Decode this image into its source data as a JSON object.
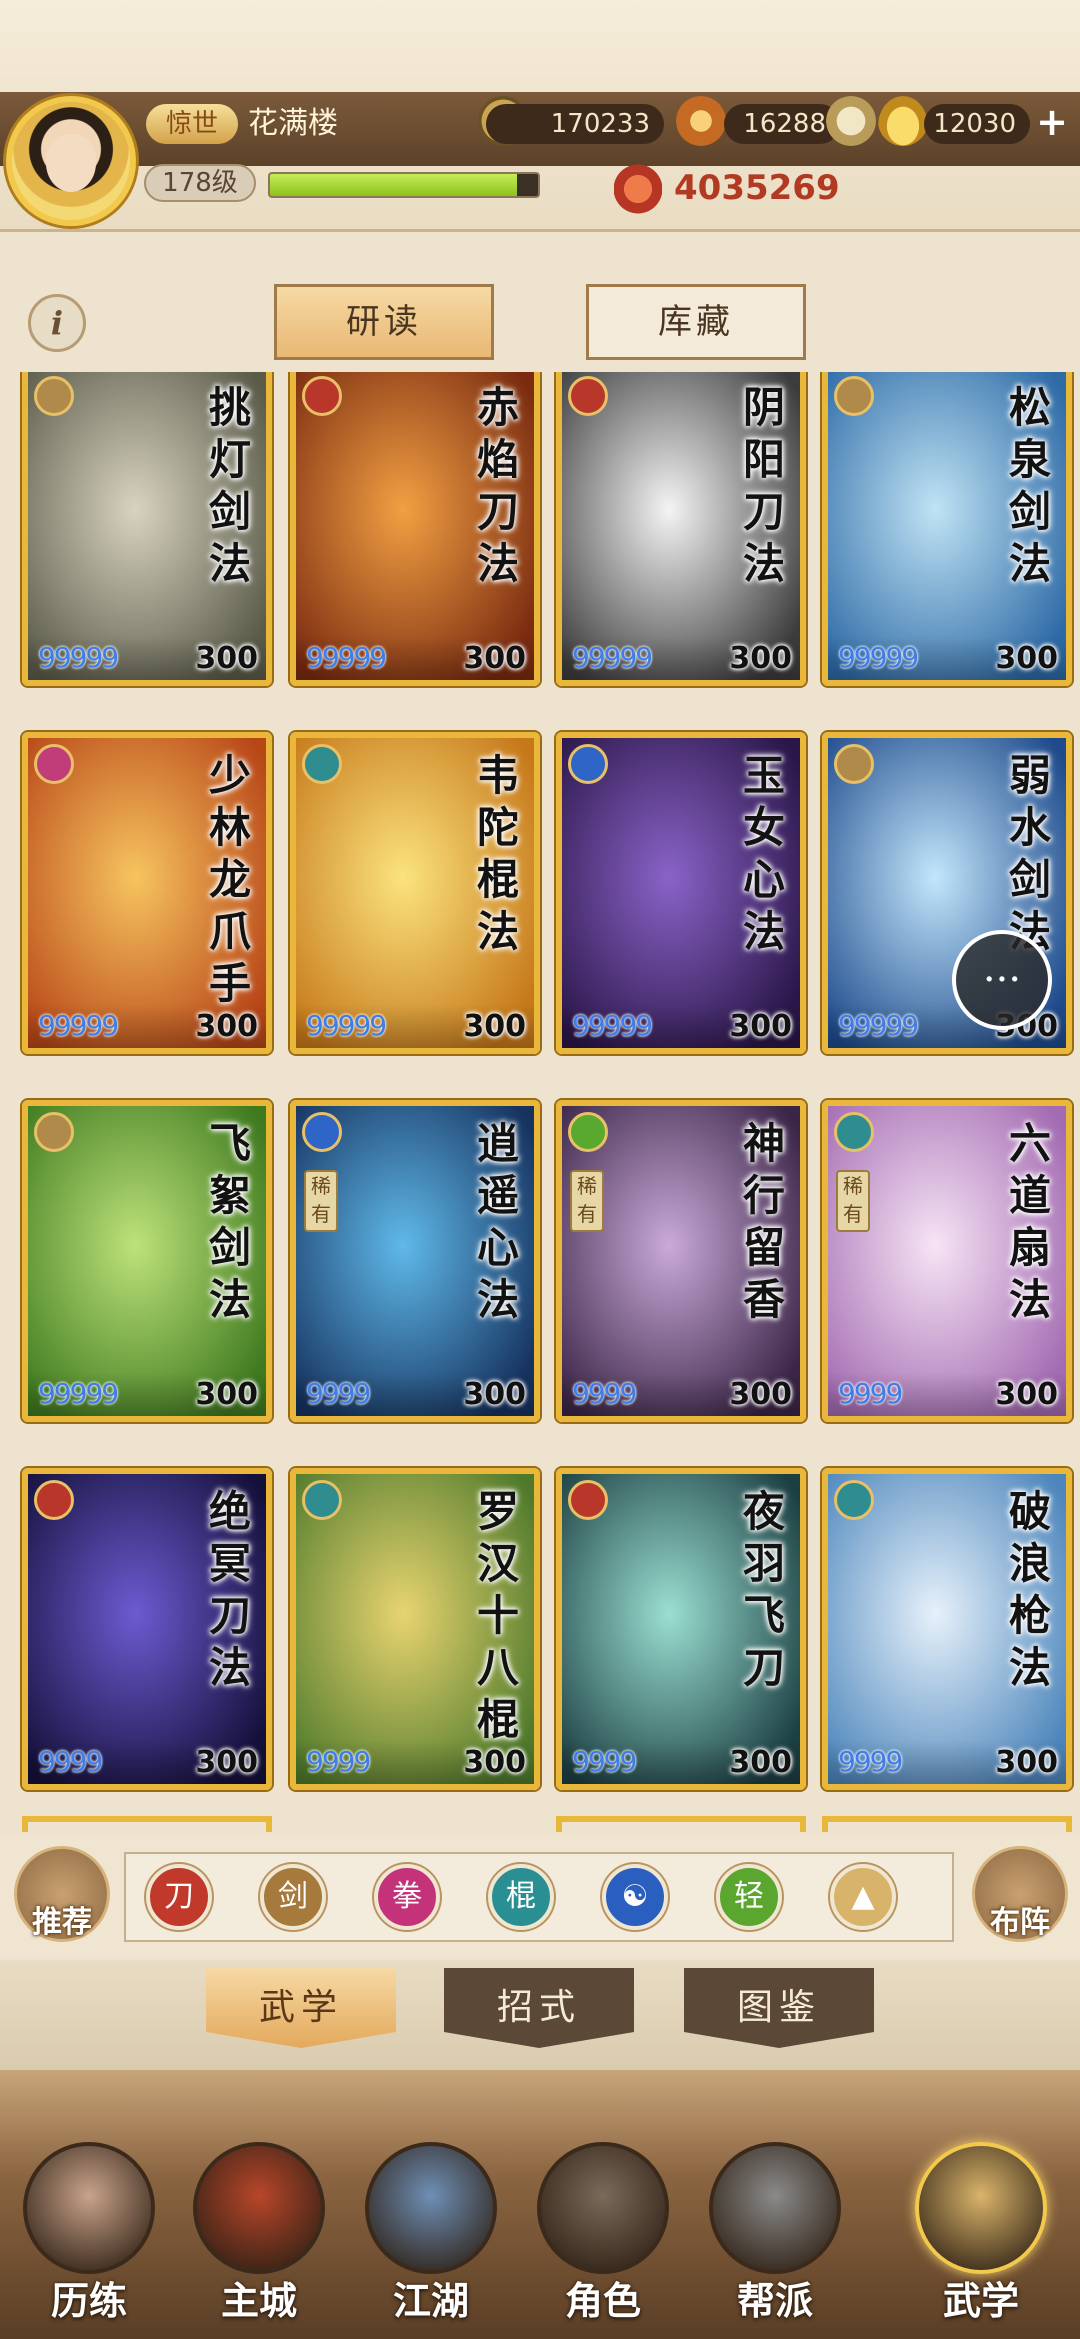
{
  "player": {
    "title": "惊世",
    "name": "花满楼",
    "level": "178级",
    "exp_fraction": 0.92,
    "power": "4035269"
  },
  "resources": [
    {
      "icon": "copper-coin-icon",
      "value": "170233",
      "color": "#8a6b2a"
    },
    {
      "icon": "gold-ore-icon",
      "value": "16288",
      "color": "#c9872a"
    },
    {
      "icon": "gold-ingot-icon",
      "value": "12030",
      "color": "#e6b532"
    }
  ],
  "top_tabs": {
    "study": "研读",
    "storage": "库藏"
  },
  "cards": [
    {
      "name": "挑灯剑法",
      "type": "sword",
      "stars": "99999",
      "num": "300",
      "rare": "",
      "bg": [
        "#d8d3c0",
        "#5b5b4a"
      ]
    },
    {
      "name": "赤焰刀法",
      "type": "blade",
      "stars": "99999",
      "num": "300",
      "rare": "",
      "bg": [
        "#f2a043",
        "#7a2b10"
      ]
    },
    {
      "name": "阴阳刀法",
      "type": "blade",
      "stars": "99999",
      "num": "300",
      "rare": "",
      "bg": [
        "#f4f4f4",
        "#3c3c3c"
      ]
    },
    {
      "name": "松泉剑法",
      "type": "sword",
      "stars": "99999",
      "num": "300",
      "rare": "",
      "bg": [
        "#bfe3f4",
        "#2e6aa6"
      ]
    },
    {
      "name": "少林龙爪手",
      "type": "fist",
      "stars": "99999",
      "num": "300",
      "rare": "",
      "bg": [
        "#f7c45f",
        "#b84718"
      ]
    },
    {
      "name": "韦陀棍法",
      "type": "staff",
      "stars": "99999",
      "num": "300",
      "rare": "",
      "bg": [
        "#fbe37d",
        "#c6781a"
      ]
    },
    {
      "name": "玉女心法",
      "type": "inner",
      "stars": "99999",
      "num": "300",
      "rare": "",
      "bg": [
        "#8a63c8",
        "#2a1648"
      ]
    },
    {
      "name": "弱水剑法",
      "type": "sword",
      "stars": "99999",
      "num": "300",
      "rare": "",
      "bg": [
        "#c2e6fb",
        "#1f4b8c"
      ]
    },
    {
      "name": "飞絮剑法",
      "type": "sword",
      "stars": "99999",
      "num": "300",
      "rare": "",
      "bg": [
        "#bde27a",
        "#3f7a1f"
      ]
    },
    {
      "name": "逍遥心法",
      "type": "inner",
      "stars": "9999",
      "num": "300",
      "rare": "稀有",
      "bg": [
        "#5fb9e9",
        "#16325f"
      ]
    },
    {
      "name": "神行留香",
      "type": "light",
      "stars": "9999",
      "num": "300",
      "rare": "稀有",
      "bg": [
        "#c9a9d8",
        "#3b2547"
      ]
    },
    {
      "name": "六道扇法",
      "type": "fan",
      "stars": "9999",
      "num": "300",
      "rare": "稀有",
      "bg": [
        "#f6e4f4",
        "#a36bb2"
      ]
    },
    {
      "name": "绝冥刀法",
      "type": "blade",
      "stars": "9999",
      "num": "300",
      "rare": "",
      "bg": [
        "#6b5bd1",
        "#14103a"
      ]
    },
    {
      "name": "罗汉十八棍",
      "type": "staff",
      "stars": "9999",
      "num": "300",
      "rare": "",
      "bg": [
        "#e8d470",
        "#4f7a2b"
      ]
    },
    {
      "name": "夜羽飞刀",
      "type": "blade",
      "stars": "9999",
      "num": "300",
      "rare": "",
      "bg": [
        "#9adfd2",
        "#1c3f42"
      ]
    },
    {
      "name": "破浪枪法",
      "type": "fan",
      "stars": "9999",
      "num": "300",
      "rare": "",
      "bg": [
        "#e6f1fa",
        "#4d86bc"
      ]
    }
  ],
  "type_colors": {
    "sword": "#b08a4a",
    "blade": "#b8362a",
    "fist": "#c03d7a",
    "staff": "#2f8c8f",
    "inner": "#2f65c6",
    "light": "#5aa92f",
    "fan": "#2f8c8f"
  },
  "filter": {
    "recommend_label": "推荐",
    "formation_label": "布阵",
    "icons": [
      {
        "name": "blade-filter-icon",
        "glyph": "刀",
        "color": "#c0392b"
      },
      {
        "name": "sword-filter-icon",
        "glyph": "剑",
        "color": "#a57a3c"
      },
      {
        "name": "fist-filter-icon",
        "glyph": "拳",
        "color": "#c4337a"
      },
      {
        "name": "staff-filter-icon",
        "glyph": "棍",
        "color": "#2a8f93"
      },
      {
        "name": "inner-filter-icon",
        "glyph": "☯",
        "color": "#2a5fbf"
      },
      {
        "name": "light-filter-icon",
        "glyph": "轻",
        "color": "#5aa62f"
      },
      {
        "name": "collapse-filter-icon",
        "glyph": "▲",
        "color": "#d7b46a"
      }
    ]
  },
  "bottom_tabs": [
    "武学",
    "招式",
    "图鉴"
  ],
  "nav": [
    {
      "label": "历练",
      "icon": "training-icon",
      "color": "#c9a38a"
    },
    {
      "label": "主城",
      "icon": "city-icon",
      "color": "#b8462a"
    },
    {
      "label": "江湖",
      "icon": "jianghu-icon",
      "color": "#6e8fb5"
    },
    {
      "label": "角色",
      "icon": "character-icon",
      "color": "#7a6a5a"
    },
    {
      "label": "帮派",
      "icon": "guild-icon",
      "color": "#8a8a8a"
    },
    {
      "label": "武学",
      "icon": "martial-arts-icon",
      "color": "#d9b46a"
    }
  ]
}
